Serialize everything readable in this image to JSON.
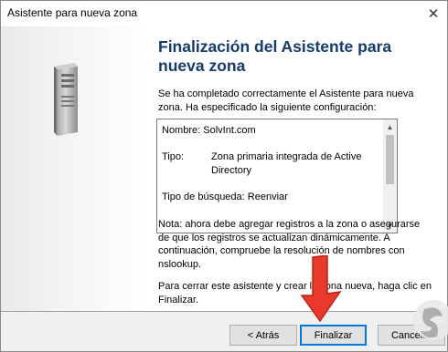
{
  "window": {
    "title": "Asistente para nueva zona",
    "close_glyph": "✕"
  },
  "wizard": {
    "heading": "Finalización del Asistente para nueva zona",
    "intro": "Se ha completado correctamente el Asistente para nueva zona. Ha especificado la siguiente configuración:",
    "summary": [
      {
        "label": "Nombre:",
        "value": "SolvInt.com"
      },
      {
        "label": "Tipo:",
        "value": "Zona primaria integrada de Active Directory"
      },
      {
        "label": "Tipo de búsqueda:",
        "value": "Reenviar"
      }
    ],
    "note": "Nota: ahora debe agregar registros a la zona o asegurarse de que los registros se actualizan dinámicamente. A continuación, compruebe la resolución de nombres con nslookup.",
    "closing": "Para cerrar este asistente y crear la zona nueva, haga clic en Finalizar."
  },
  "buttons": {
    "back": "< Atrás",
    "finish": "Finalizar",
    "cancel": "Cancelar"
  },
  "icons": {
    "server": "server-icon",
    "arrow": "red-arrow-annotation",
    "watermark": "watermark-logo"
  },
  "colors": {
    "heading": "#163c6b",
    "accent": "#0078d7",
    "arrow": "#e8392b"
  }
}
